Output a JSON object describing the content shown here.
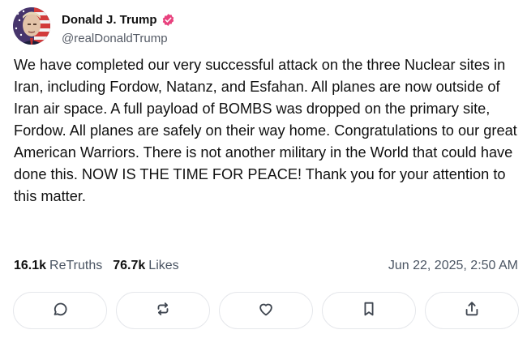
{
  "author": {
    "display_name": "Donald J. Trump",
    "handle": "@realDonaldTrump",
    "verified_color": "#e8427e"
  },
  "post": {
    "text": "We have completed our very successful attack on the three Nuclear sites in Iran, including Fordow, Natanz, and Esfahan. All planes are now outside of Iran air space. A full payload of BOMBS was dropped on the primary site, Fordow. All planes are safely on their way home. Congratulations to our great American Warriors. There is not another military in the World that could have done this. NOW IS THE TIME FOR PEACE! Thank you for your attention to this matter.",
    "retruths_count": "16.1k",
    "retruths_label": "ReTruths",
    "likes_count": "76.7k",
    "likes_label": "Likes",
    "timestamp": "Jun 22, 2025, 2:50 AM"
  },
  "actions": [
    {
      "icon": "reply-icon"
    },
    {
      "icon": "retruth-icon"
    },
    {
      "icon": "like-icon"
    },
    {
      "icon": "bookmark-icon"
    },
    {
      "icon": "share-icon"
    }
  ]
}
